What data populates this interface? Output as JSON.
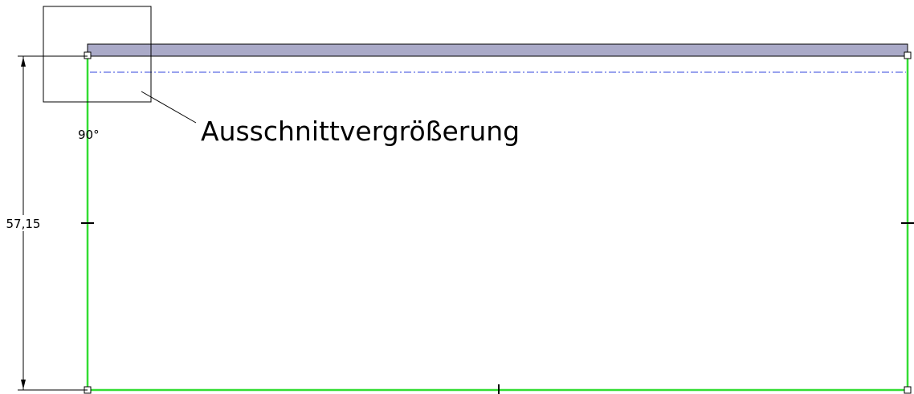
{
  "drawing": {
    "dimension_value": "57,15",
    "angle_label": "90°",
    "callout_label": "Ausschnittvergrößerung",
    "colors": {
      "sketch_line": "#33dd33",
      "flange_fill": "#aaaac8",
      "centerline": "#3344dd",
      "ink": "#000000"
    }
  }
}
